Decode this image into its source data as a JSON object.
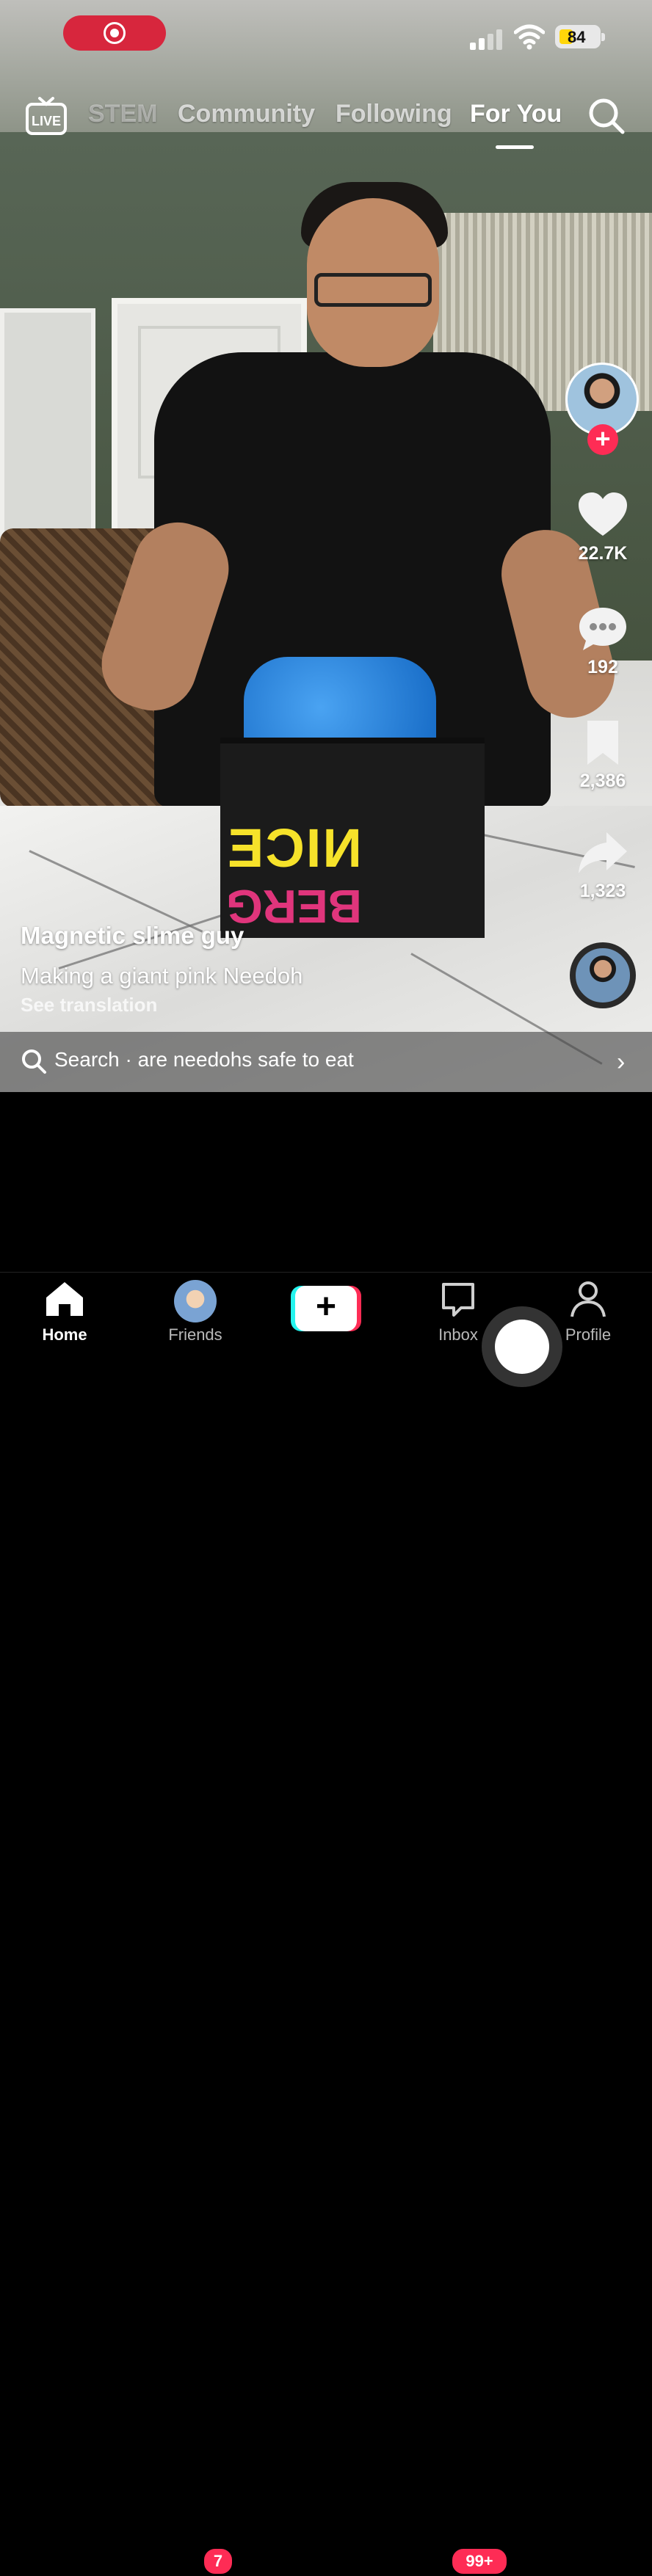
{
  "status_bar": {
    "battery": "84"
  },
  "top_nav": {
    "live_label": "LIVE",
    "tabs": [
      {
        "label": "STEM"
      },
      {
        "label": "Community"
      },
      {
        "label": "Following"
      },
      {
        "label": "For You",
        "active": true
      }
    ]
  },
  "video": {
    "author": "Magnetic slime guy",
    "description": "Making a giant pink Needoh",
    "translation": "See translation",
    "box_text_top": "NICE",
    "box_text_bottom": "BERG"
  },
  "actions": {
    "likes": "22.7K",
    "comments": "192",
    "saves": "2,386",
    "shares": "1,323"
  },
  "search_bar": {
    "text": "Search · are needohs safe to eat"
  },
  "bottom_nav": {
    "home": "Home",
    "friends": "Friends",
    "friends_badge": "7",
    "inbox": "Inbox",
    "inbox_badge": "99+",
    "profile": "Profile"
  },
  "colors": {
    "accent": "#fe2c55",
    "cyan": "#25f4ee",
    "record": "#d7263d"
  }
}
